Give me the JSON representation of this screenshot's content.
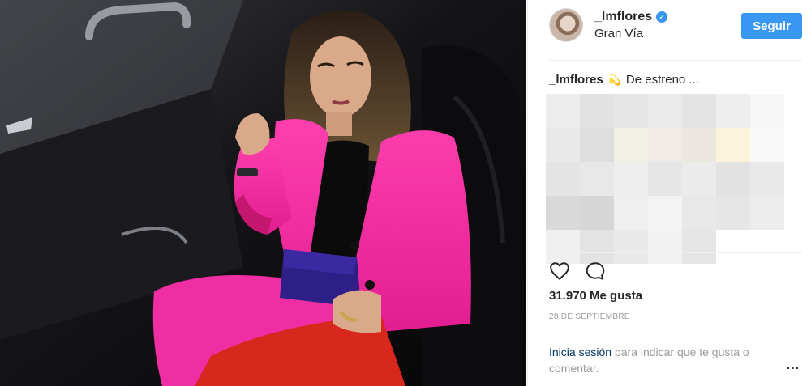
{
  "post": {
    "username": "_lmflores",
    "location": "Gran Vía",
    "follow_label": "Seguir",
    "caption_user": "_lmflores",
    "caption_emoji": "💫",
    "caption_text": "De estreno ...",
    "likes": "31.970 Me gusta",
    "date": "28 DE SEPTIEMBRE",
    "login_link": "Inicia sesión",
    "login_rest": " para indicar que te gusta o comentar.",
    "more_label": "..."
  },
  "icons": {
    "like": "heart-icon",
    "comment": "comment-icon",
    "verified": "verified-badge-icon",
    "more": "more-options-icon"
  },
  "colors": {
    "accent": "#3897f0",
    "link": "#003569",
    "muted": "#999999",
    "text": "#262626"
  },
  "blur_tiles": [
    "#ededed",
    "#e2e2e2",
    "#e6e6e6",
    "#ebebeb",
    "#e4e4e4",
    "#eeeeee",
    "#f6f6f6",
    "#e9e9e9",
    "#dedede",
    "#f2efe6",
    "#f0ebe6",
    "#ece6e0",
    "#fbf3da",
    "#f9f9f9",
    "#e4e4e4",
    "#e8e8e8",
    "#eeeeee",
    "#e6e6e6",
    "#ebebeb",
    "#e2e2e2",
    "#e8e8e8",
    "#d9d9d9",
    "#d6d6d6",
    "#efefef",
    "#f3f3f3",
    "#e8e8e8",
    "#e6e6e6",
    "#ececec",
    "#f0f0f0",
    "#e3e3e3",
    "#e9e9e9",
    "#f1f1f1",
    "#e5e5e5",
    "#ffffff",
    "#ffffff"
  ]
}
